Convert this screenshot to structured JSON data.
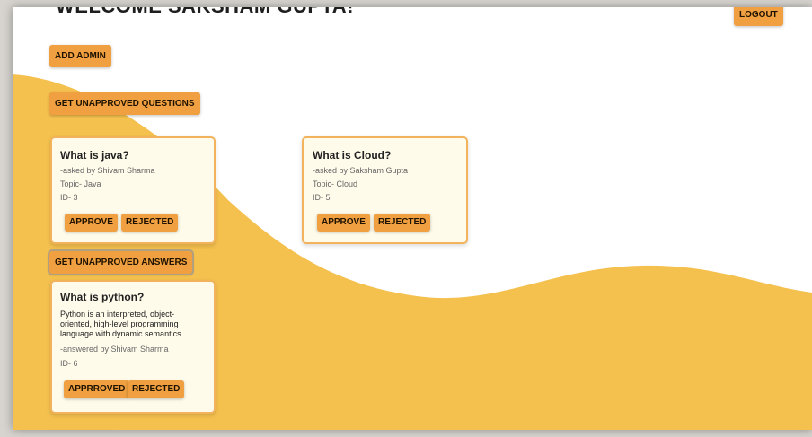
{
  "header": {
    "welcome": "WELCOME SAKSHAM GUPTA!",
    "logout_label": "LOGOUT"
  },
  "actions": {
    "add_admin_label": "ADD ADMIN",
    "get_questions_label": "GET UNAPPROVED QUESTIONS",
    "get_answers_label": "GET UNAPPROVED ANSWERS"
  },
  "questions": [
    {
      "title": "What is java?",
      "asked_by": "-asked by Shivam Sharma",
      "topic": "Topic- Java",
      "id": "ID- 3",
      "approve_label": "APPROVE",
      "reject_label": "REJECTED"
    },
    {
      "title": "What is Cloud?",
      "asked_by": "-asked by Saksham Gupta",
      "topic": "Topic- Cloud",
      "id": "ID- 5",
      "approve_label": "APPROVE",
      "reject_label": "REJECTED"
    }
  ],
  "answers": [
    {
      "title": "What is python?",
      "body_lines": [
        "Python is an interpreted, object-",
        "oriented, high-level programming",
        "language with dynamic semantics."
      ],
      "answered_by": "-answered by Shivam Sharma",
      "id": "ID- 6",
      "approve_label": "APPRROVED",
      "reject_label": "REJECTED"
    }
  ],
  "colors": {
    "accent": "#f0a040",
    "wave": "#f4c04e",
    "card_bg": "#fffbea",
    "card_border": "#f2b35c"
  }
}
